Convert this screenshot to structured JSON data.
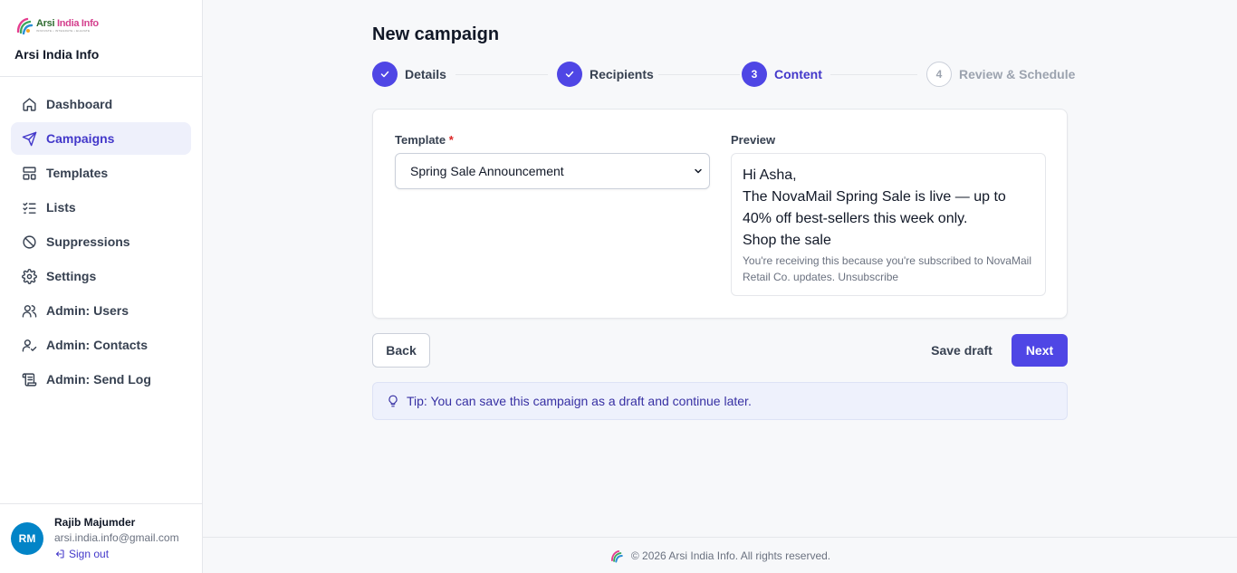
{
  "brand": {
    "logo_word1": "Arsi ",
    "logo_word2": "India Info",
    "logo_tagline": "INNOVATE • INTEGRATE • ELEVATE",
    "name": "Arsi India Info"
  },
  "sidebar": {
    "items": [
      {
        "label": "Dashboard",
        "icon": "home-icon",
        "active": false
      },
      {
        "label": "Campaigns",
        "icon": "send-icon",
        "active": true
      },
      {
        "label": "Templates",
        "icon": "layout-icon",
        "active": false
      },
      {
        "label": "Lists",
        "icon": "list-check-icon",
        "active": false
      },
      {
        "label": "Suppressions",
        "icon": "ban-icon",
        "active": false
      },
      {
        "label": "Settings",
        "icon": "gear-icon",
        "active": false
      },
      {
        "label": "Admin: Users",
        "icon": "users-icon",
        "active": false
      },
      {
        "label": "Admin: Contacts",
        "icon": "user-check-icon",
        "active": false
      },
      {
        "label": "Admin: Send Log",
        "icon": "scroll-icon",
        "active": false
      }
    ]
  },
  "user": {
    "initials": "RM",
    "name": "Rajib Majumder",
    "email": "arsi.india.info@gmail.com",
    "signout_label": "Sign out"
  },
  "page": {
    "title": "New campaign"
  },
  "stepper": {
    "steps": [
      {
        "number": "",
        "label": "Details",
        "state": "done"
      },
      {
        "number": "",
        "label": "Recipients",
        "state": "done"
      },
      {
        "number": "3",
        "label": "Content",
        "state": "current"
      },
      {
        "number": "4",
        "label": "Review & Schedule",
        "state": "upcoming"
      }
    ]
  },
  "form": {
    "template_label": "Template",
    "required_mark": "*",
    "template_value": "Spring Sale Announcement",
    "preview_label": "Preview"
  },
  "preview": {
    "greeting": "Hi Asha,",
    "line1": "The NovaMail Spring Sale is live — up to",
    "line2": "40% off best-sellers this week only.",
    "cta": "Shop the sale",
    "footer_note": "You're receiving this because you're subscribed to NovaMail Retail Co. updates. Unsubscribe"
  },
  "actions": {
    "back_label": "Back",
    "draft_label": "Save draft",
    "next_label": "Next"
  },
  "tip": {
    "text": "Tip: You can save this campaign as a draft and continue later."
  },
  "footer": {
    "text": "© 2026 Arsi India Info. All rights reserved."
  },
  "colors": {
    "accent": "#4f46e5",
    "active_nav_bg": "#eef0fb",
    "avatar": "#0284c7",
    "tip_bg": "#eef1fc"
  }
}
